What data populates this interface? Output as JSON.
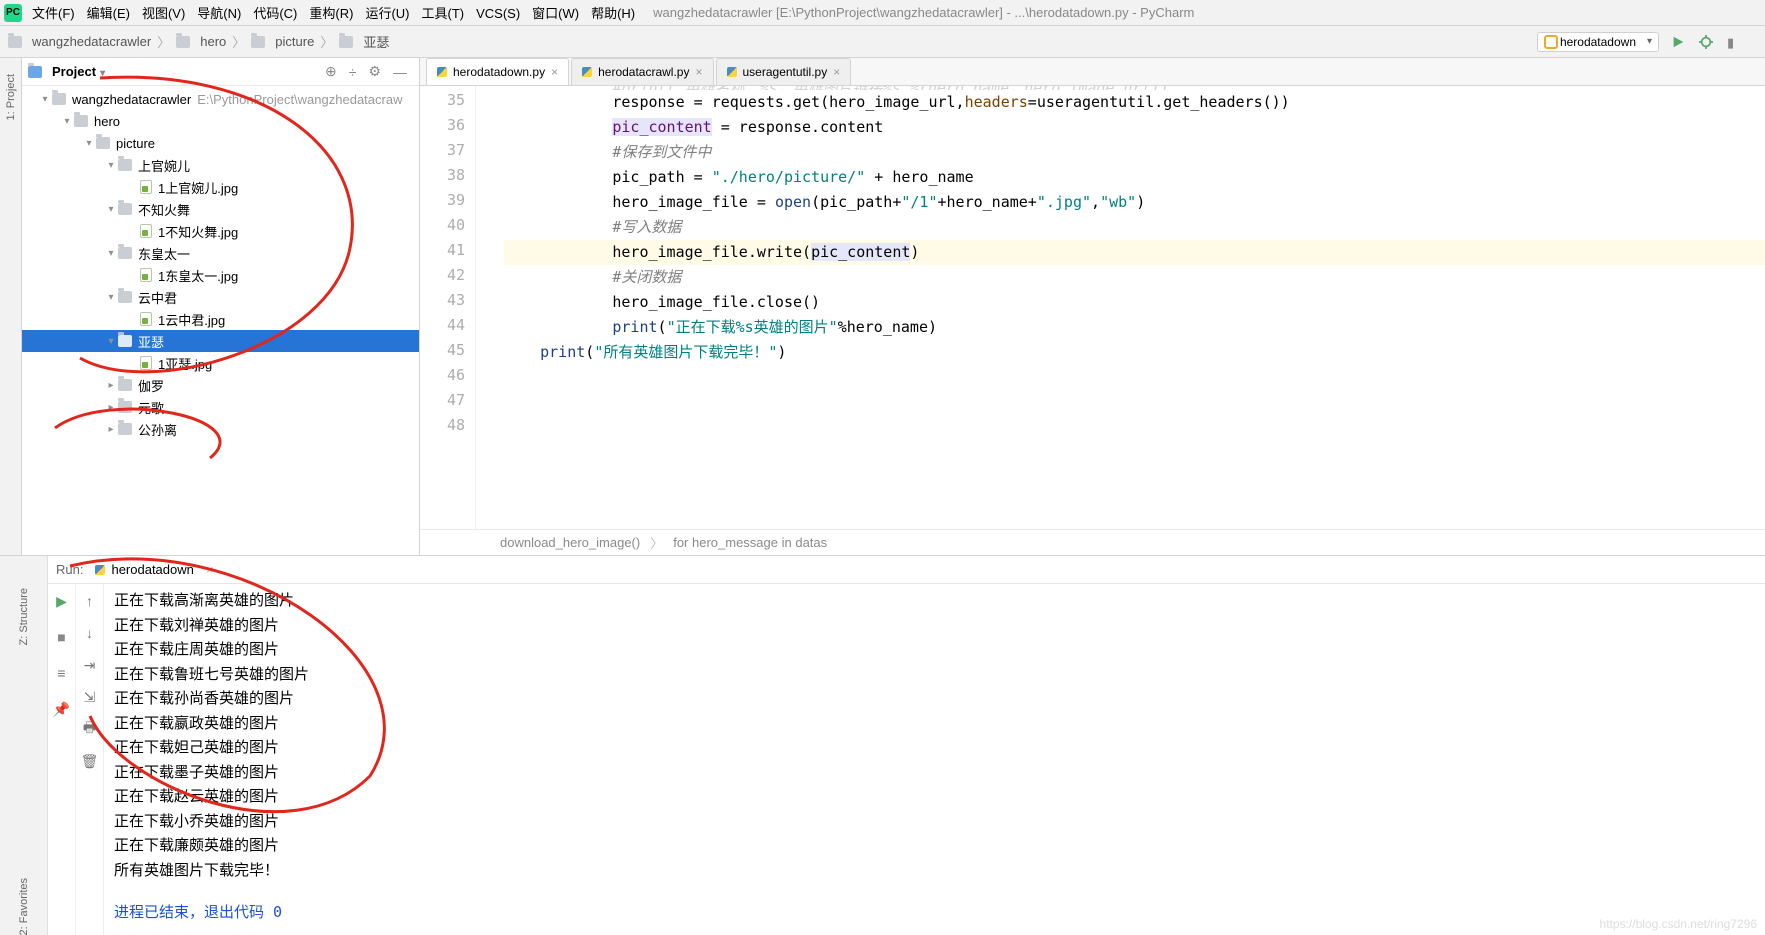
{
  "window": {
    "title_project": "wangzhedatacrawler",
    "title_path": "wangzhedatacrawler [E:\\PythonProject\\wangzhedatacrawler] - ...\\herodatadown.py - PyCharm"
  },
  "menubar": [
    "文件(F)",
    "编辑(E)",
    "视图(V)",
    "导航(N)",
    "代码(C)",
    "重构(R)",
    "运行(U)",
    "工具(T)",
    "VCS(S)",
    "窗口(W)",
    "帮助(H)"
  ],
  "breadcrumb": [
    "wangzhedatacrawler",
    "hero",
    "picture",
    "亚瑟"
  ],
  "run_config": "herodatadown",
  "side_tabs": [
    "1: Project"
  ],
  "bottom_tabs": [
    "2: Favorites",
    "Z: Structure"
  ],
  "project_panel_title": "Project",
  "tree": [
    {
      "depth": 0,
      "arrow": "down",
      "icon": "folder",
      "label": "wangzhedatacrawler",
      "hint": "E:\\PythonProject\\wangzhedatacraw"
    },
    {
      "depth": 1,
      "arrow": "down",
      "icon": "folder",
      "label": "hero"
    },
    {
      "depth": 2,
      "arrow": "down",
      "icon": "folder",
      "label": "picture"
    },
    {
      "depth": 3,
      "arrow": "down",
      "icon": "folder",
      "label": "上官婉儿"
    },
    {
      "depth": 4,
      "arrow": "none",
      "icon": "file",
      "label": "1上官婉儿.jpg"
    },
    {
      "depth": 3,
      "arrow": "down",
      "icon": "folder",
      "label": "不知火舞"
    },
    {
      "depth": 4,
      "arrow": "none",
      "icon": "file",
      "label": "1不知火舞.jpg"
    },
    {
      "depth": 3,
      "arrow": "down",
      "icon": "folder",
      "label": "东皇太一"
    },
    {
      "depth": 4,
      "arrow": "none",
      "icon": "file",
      "label": "1东皇太一.jpg"
    },
    {
      "depth": 3,
      "arrow": "down",
      "icon": "folder",
      "label": "云中君"
    },
    {
      "depth": 4,
      "arrow": "none",
      "icon": "file",
      "label": "1云中君.jpg"
    },
    {
      "depth": 3,
      "arrow": "down",
      "icon": "folder",
      "label": "亚瑟",
      "selected": true
    },
    {
      "depth": 4,
      "arrow": "none",
      "icon": "file",
      "label": "1亚瑟.jpg"
    },
    {
      "depth": 3,
      "arrow": "right",
      "icon": "folder",
      "label": "伽罗"
    },
    {
      "depth": 3,
      "arrow": "right",
      "icon": "folder",
      "label": "元歌"
    },
    {
      "depth": 3,
      "arrow": "right",
      "icon": "folder",
      "label": "公孙离"
    }
  ],
  "tabs": [
    {
      "label": "herodatadown.py",
      "active": true
    },
    {
      "label": "herodatacrawl.py",
      "active": false
    },
    {
      "label": "useragentutil.py",
      "active": false
    }
  ],
  "gutter_start": 35,
  "code": [
    {
      "n": 35,
      "indent": 3,
      "tokens": [
        {
          "t": "#print(\"英雄名称：%s，英雄图片链接%s\"%(hero_name，hero_image_url))",
          "c": "s-cmt"
        }
      ],
      "cut": true
    },
    {
      "n": 36,
      "indent": 3,
      "tokens": [
        {
          "t": "response = requests.get(hero_image_url,"
        },
        {
          "t": "headers",
          "c": "s-param"
        },
        {
          "t": "=useragentutil.get_headers())"
        }
      ]
    },
    {
      "n": 37,
      "indent": 3,
      "tokens": [
        {
          "t": "pic_content",
          "c": "s-name",
          "bg": true
        },
        {
          "t": " = response.content"
        }
      ]
    },
    {
      "n": 38,
      "indent": 3,
      "tokens": [
        {
          "t": "#保存到文件中",
          "c": "s-cmt"
        }
      ]
    },
    {
      "n": 39,
      "indent": 3,
      "tokens": [
        {
          "t": "pic_path = "
        },
        {
          "t": "\"./hero/picture/\"",
          "c": "s-str"
        },
        {
          "t": " + hero_name"
        }
      ]
    },
    {
      "n": 40,
      "indent": 3,
      "tokens": [
        {
          "t": "hero_image_file = "
        },
        {
          "t": "open",
          "c": "s-kw"
        },
        {
          "t": "(pic_path+"
        },
        {
          "t": "\"/1\"",
          "c": "s-str"
        },
        {
          "t": "+hero_name+"
        },
        {
          "t": "\".jpg\"",
          "c": "s-str"
        },
        {
          "t": ","
        },
        {
          "t": "\"wb\"",
          "c": "s-str"
        },
        {
          "t": ")"
        }
      ]
    },
    {
      "n": 41,
      "indent": 3,
      "tokens": [
        {
          "t": "#写入数据",
          "c": "s-cmt"
        }
      ]
    },
    {
      "n": 42,
      "indent": 3,
      "hl": true,
      "tokens": [
        {
          "t": "hero_image_file.write("
        },
        {
          "t": "pic_content",
          "bg": true
        },
        {
          "t": ")"
        }
      ]
    },
    {
      "n": 43,
      "indent": 3,
      "tokens": [
        {
          "t": "#关闭数据",
          "c": "s-cmt"
        }
      ]
    },
    {
      "n": 44,
      "indent": 3,
      "tokens": [
        {
          "t": "hero_image_file.close()"
        }
      ]
    },
    {
      "n": 45,
      "indent": 3,
      "tokens": [
        {
          "t": "print",
          "c": "s-kw"
        },
        {
          "t": "("
        },
        {
          "t": "\"正在下载%s英雄的图片\"",
          "c": "s-str"
        },
        {
          "t": "%hero_name)"
        }
      ]
    },
    {
      "n": 46,
      "indent": 1,
      "tokens": [
        {
          "t": "print",
          "c": "s-kw"
        },
        {
          "t": "("
        },
        {
          "t": "\"所有英雄图片下载完毕！\"",
          "c": "s-str"
        },
        {
          "t": ")"
        }
      ]
    },
    {
      "n": 47,
      "indent": 0,
      "tokens": []
    },
    {
      "n": 48,
      "indent": 0,
      "tokens": []
    }
  ],
  "editor_crumbs": [
    "download_hero_image()",
    "for hero_message in datas"
  ],
  "run_panel": {
    "label": "Run:",
    "name": "herodatadown",
    "lines": [
      "正在下载高渐离英雄的图片",
      "正在下载刘禅英雄的图片",
      "正在下载庄周英雄的图片",
      "正在下载鲁班七号英雄的图片",
      "正在下载孙尚香英雄的图片",
      "正在下载嬴政英雄的图片",
      "正在下载妲己英雄的图片",
      "正在下载墨子英雄的图片",
      "正在下载赵云英雄的图片",
      "正在下载小乔英雄的图片",
      "正在下载廉颇英雄的图片",
      "所有英雄图片下载完毕！"
    ],
    "exit": "进程已结束，退出代码 0"
  },
  "watermark": "https://blog.csdn.net/ring7296"
}
